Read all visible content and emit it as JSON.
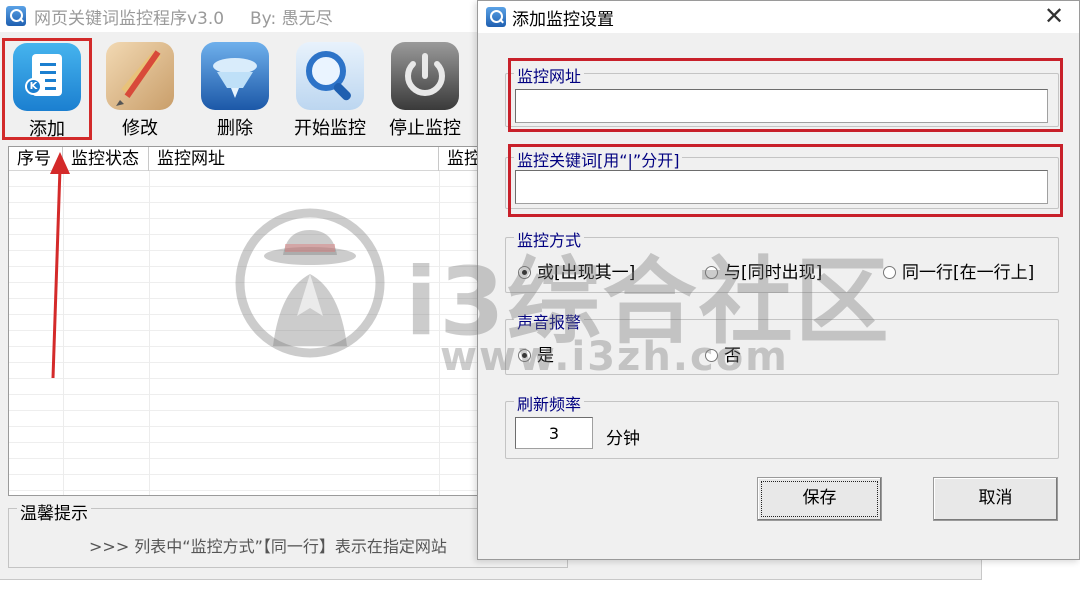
{
  "main_window": {
    "title": "网页关键词监控程序v3.0",
    "author": "By: 愚无尽",
    "toolbar": [
      {
        "key": "add",
        "label": "添加",
        "icon": "add-doc-icon"
      },
      {
        "key": "edit",
        "label": "修改",
        "icon": "pencil-ruler-icon"
      },
      {
        "key": "delete",
        "label": "删除",
        "icon": "delete-icon"
      },
      {
        "key": "start",
        "label": "开始监控",
        "icon": "magnifier-icon"
      },
      {
        "key": "stop",
        "label": "停止监控",
        "icon": "power-icon"
      }
    ],
    "list_columns": [
      "序号",
      "监控状态",
      "监控网址",
      "监控"
    ],
    "tips": {
      "title": "温馨提示",
      "text": ">>> 列表中“监控方式”【同一行】表示在指定网站"
    }
  },
  "dialog": {
    "title": "添加监控设置",
    "close_symbol": "✕",
    "url_group": {
      "label": "监控网址",
      "value": ""
    },
    "keyword_group": {
      "label": "监控关键词[用“|”分开]",
      "value": ""
    },
    "mode_group": {
      "label": "监控方式",
      "options": [
        "或[出现其一]",
        "与[同时出现]",
        "同一行[在一行上]"
      ],
      "selected": 0
    },
    "sound_group": {
      "label": "声音报警",
      "options": [
        "是",
        "否"
      ],
      "selected": 0
    },
    "refresh_group": {
      "label": "刷新频率",
      "value": "3",
      "unit": "分钟"
    },
    "save_label": "保存",
    "cancel_label": "取消"
  },
  "watermark": {
    "name": "i3综合社区",
    "url": "www.i3zh.com"
  },
  "colors": {
    "highlight_red": "#c8202a",
    "group_title": "#000080",
    "window_bg": "#f0f0f0"
  }
}
